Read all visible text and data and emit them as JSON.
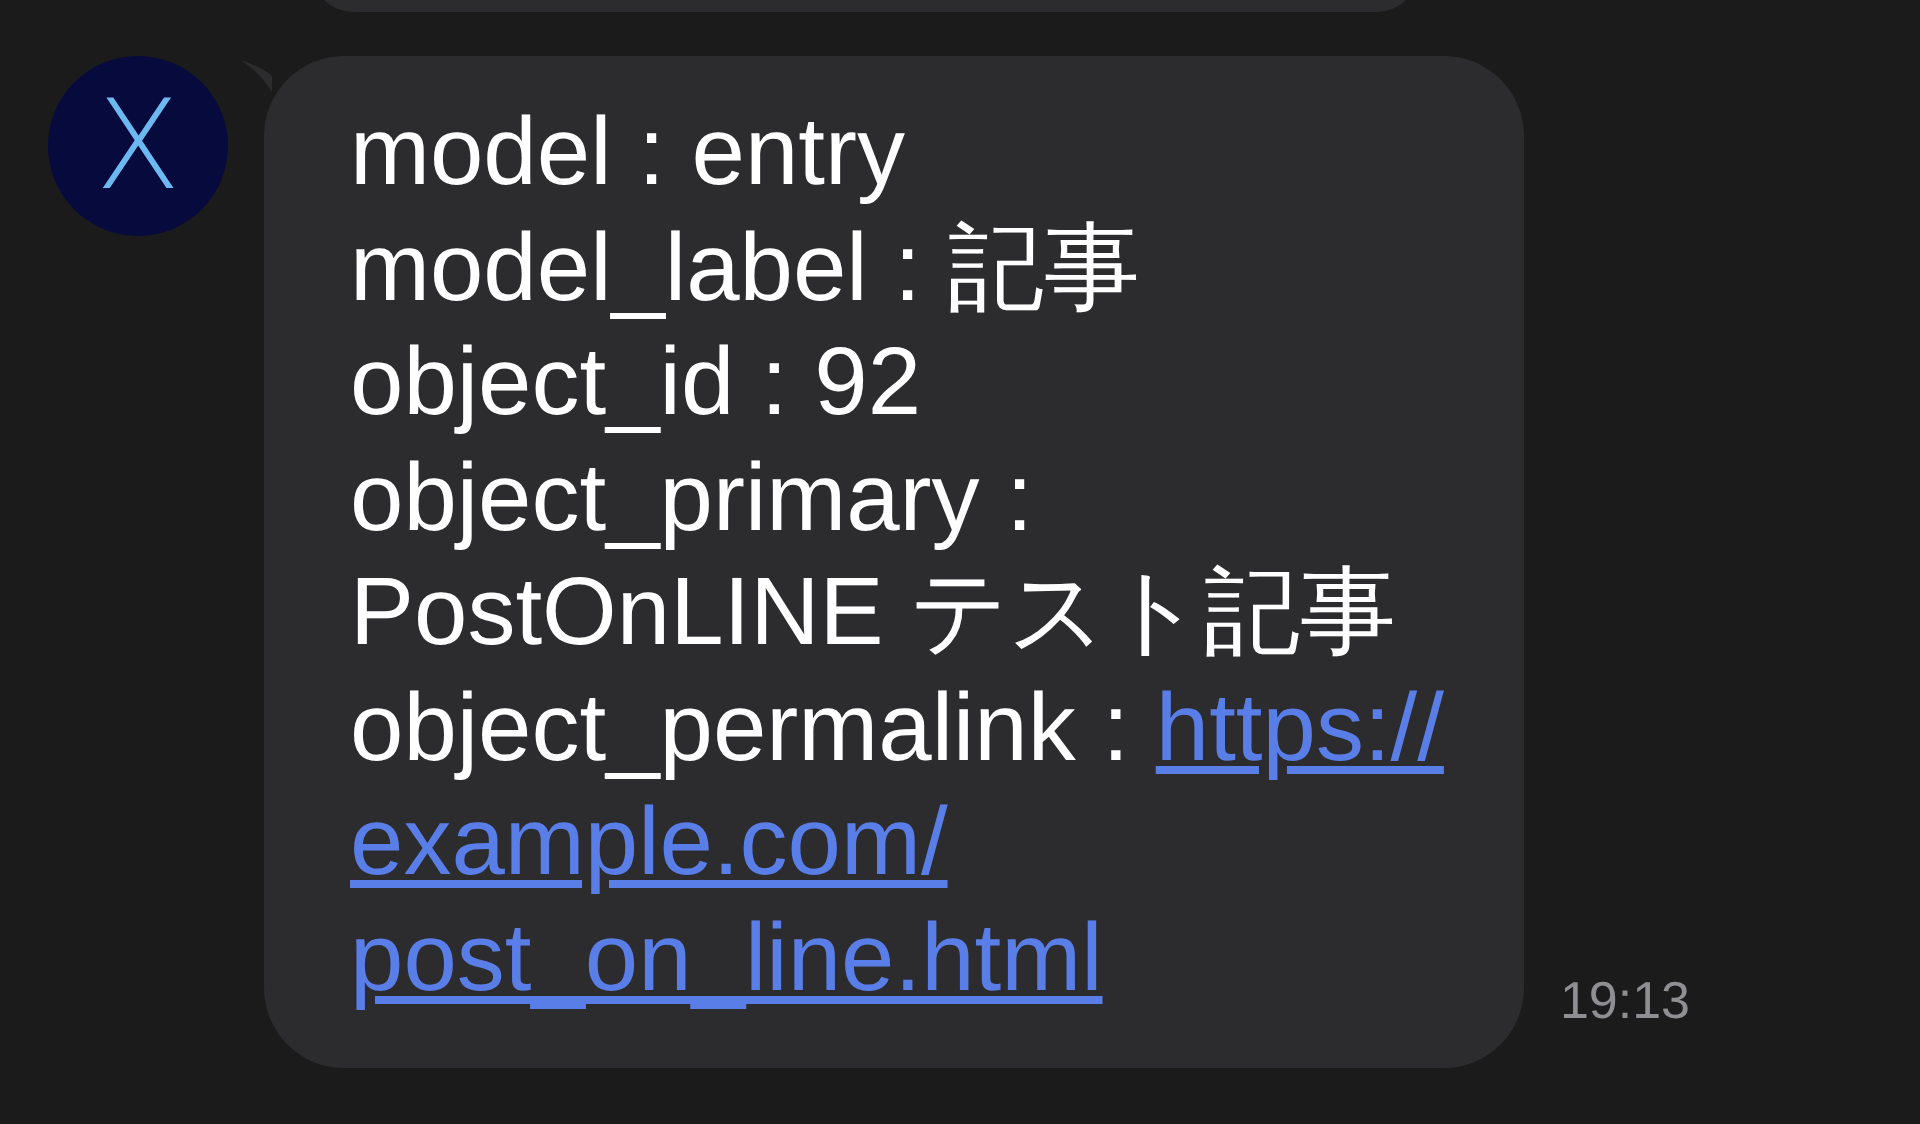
{
  "avatar": {
    "letter": "X"
  },
  "message": {
    "lines": [
      {
        "text": "model : entry"
      },
      {
        "text": "model_label : 記事"
      },
      {
        "text": "object_id : 92"
      },
      {
        "text": "object_primary :"
      },
      {
        "text": "PostOnLINE テスト記事"
      },
      {
        "text": "object_permalink :",
        "link": "https://"
      },
      {
        "link": "example.com/"
      },
      {
        "link": "post_on_line.html"
      }
    ],
    "time": "19:13"
  }
}
